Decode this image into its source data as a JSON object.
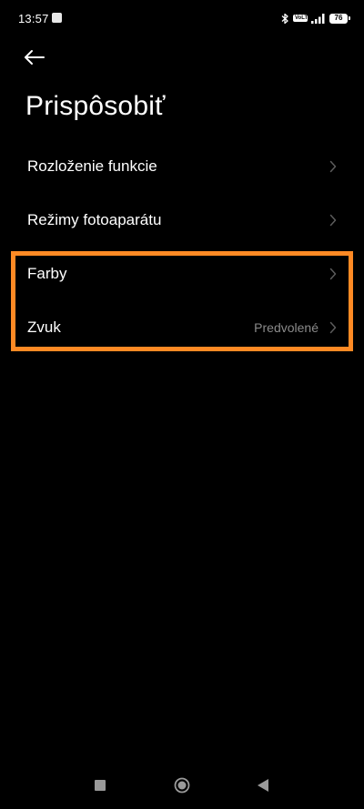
{
  "status_bar": {
    "time": "13:57",
    "volte_label": "VoLTE",
    "battery_level": "76"
  },
  "header": {
    "title": "Prispôsobiť"
  },
  "settings": {
    "items": [
      {
        "label": "Rozloženie funkcie",
        "value": ""
      },
      {
        "label": "Režimy fotoaparátu",
        "value": ""
      },
      {
        "label": "Farby",
        "value": ""
      },
      {
        "label": "Zvuk",
        "value": "Predvolené"
      }
    ]
  },
  "colors": {
    "background": "#000000",
    "highlight": "#ff8a24",
    "secondary_text": "#8a8a8a"
  },
  "icons": {
    "back": "arrow-left-icon",
    "chevron": "chevron-right-icon",
    "bluetooth": "bluetooth-icon",
    "signal": "signal-icon",
    "battery": "battery-icon"
  }
}
